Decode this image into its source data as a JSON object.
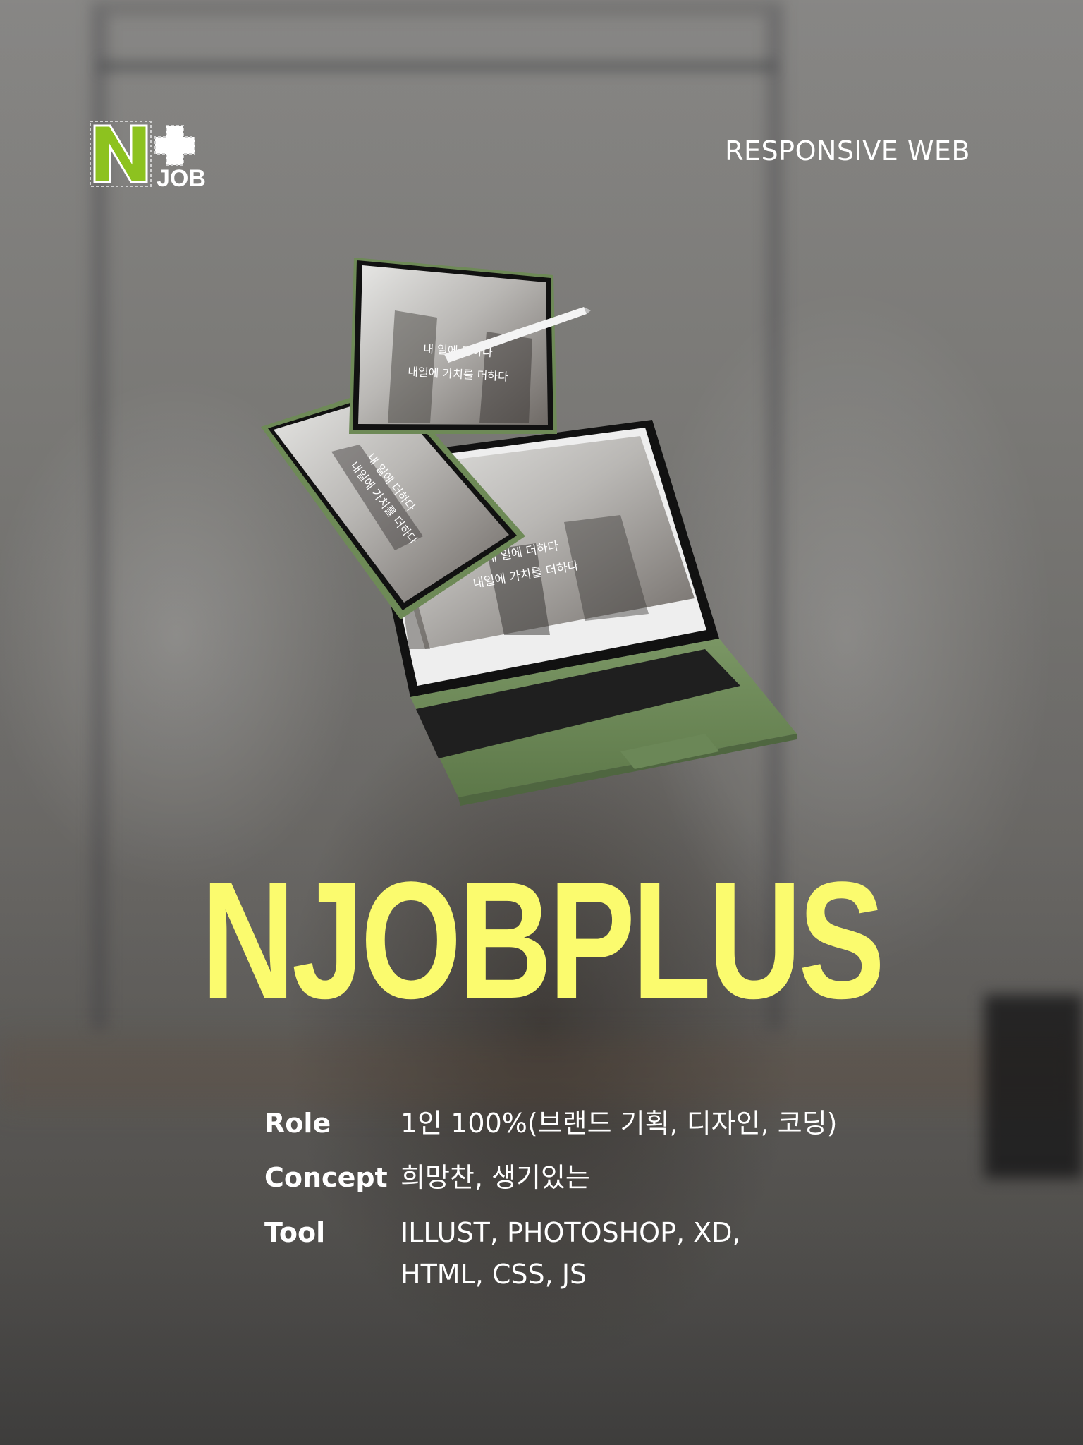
{
  "header": {
    "logo_text": "JOB",
    "logo_letter": "N",
    "category_label": "RESPONSIVE WEB"
  },
  "devices": {
    "screen_text_line1": "내 일에 더하다",
    "screen_text_line2": "내일에 가치를 더하다"
  },
  "title": "NJOBPLUS",
  "info": {
    "role": {
      "label": "Role",
      "value": "1인 100%(브랜드 기획, 디자인, 코딩)"
    },
    "concept": {
      "label": "Concept",
      "value": "희망찬, 생기있는"
    },
    "tool": {
      "label": "Tool",
      "value_line1": "ILLUST, PHOTOSHOP, XD,",
      "value_line2": "HTML, CSS, JS"
    }
  },
  "colors": {
    "title": "#fbfb6e",
    "logo_green": "#8dc21f",
    "device_green": "#6e8a57"
  }
}
